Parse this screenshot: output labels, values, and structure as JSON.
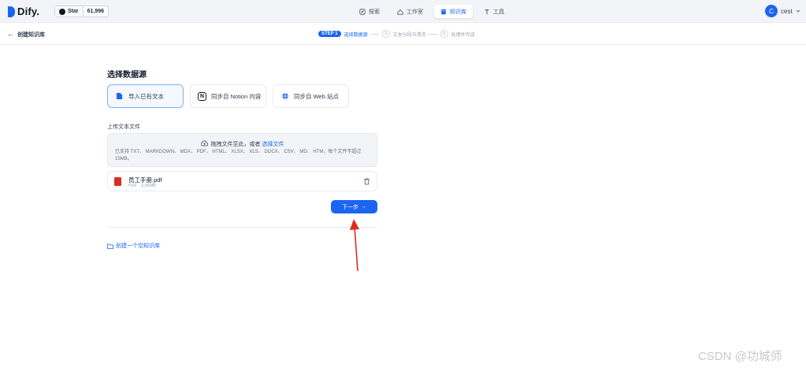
{
  "topbar": {
    "logo_text": "Dify.",
    "star_label": "Star",
    "star_count": "61,996",
    "nav": [
      {
        "label": "探索"
      },
      {
        "label": "工作室"
      },
      {
        "label": "知识库",
        "active": true
      },
      {
        "label": "工具"
      }
    ],
    "user_initial": "C",
    "user_name": "cest"
  },
  "subbar": {
    "back_symbol": "←",
    "title": "创建知识库",
    "step_badge": "STEP 1",
    "step1_label": "选择数据源",
    "step2_num": "2",
    "step2_label": "文本分段与清洗",
    "step3_num": "3",
    "step3_label": "处理并完成"
  },
  "main": {
    "section_title": "选择数据源",
    "sources": [
      {
        "label": "导入已有文本",
        "icon": "file-icon",
        "selected": true
      },
      {
        "label": "同步自 Notion 内容",
        "icon": "notion-icon"
      },
      {
        "label": "同步自 Web 站点",
        "icon": "web-icon"
      }
    ],
    "upload_label": "上传文本文件",
    "drop_text": "拖拽文件至此，或者",
    "drop_link": "选择文件",
    "drop_hint": "已支持 TXT、 MARKDOWN、 MDX、 PDF、 HTML、 XLSX、 XLS、 DOCX、 CSV、 MD、 HTM，每个文件不超过 15MB。",
    "file_name": "员工手册.pdf",
    "file_meta": "PDF · 3.35MB",
    "next_label": "下一步",
    "next_arrow": "→",
    "empty_link": "创建一个空知识库"
  },
  "watermark": "CSDN @功城师",
  "colors": {
    "accent": "#1c64f2",
    "annotation_arrow": "#e02b20"
  }
}
